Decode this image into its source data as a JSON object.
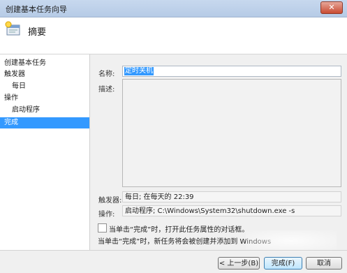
{
  "window": {
    "title": "创建基本任务向导",
    "close_glyph": "✕"
  },
  "header": {
    "title": "摘要",
    "icon": "task-wizard-icon"
  },
  "sidebar": {
    "items": [
      {
        "label": "创建基本任务",
        "selected": false
      },
      {
        "label": "触发器",
        "selected": false
      },
      {
        "label": "每日",
        "selected": false
      },
      {
        "label": "操作",
        "selected": false
      },
      {
        "label": "启动程序",
        "selected": false
      },
      {
        "label": "完成",
        "selected": true
      }
    ]
  },
  "form": {
    "name_label": "名称:",
    "name_value": "定时关机",
    "description_label": "描述:",
    "description_value": "",
    "trigger_label": "触发器:",
    "trigger_value": "每日; 在每天的 22:39",
    "action_label": "操作:",
    "action_value": "启动程序; C:\\Windows\\System32\\shutdown.exe -s"
  },
  "checkbox": {
    "label": "当单击“完成”时，打开此任务属性的对话框。",
    "checked": false
  },
  "note": "当单击“完成”时，新任务将会被创建并添加到 Windows",
  "buttons": {
    "back": "< 上一步(B)",
    "finish": "完成(F)",
    "cancel": "取消"
  },
  "colors": {
    "selection": "#3399ff",
    "titlebar": "#c7d8ee"
  }
}
